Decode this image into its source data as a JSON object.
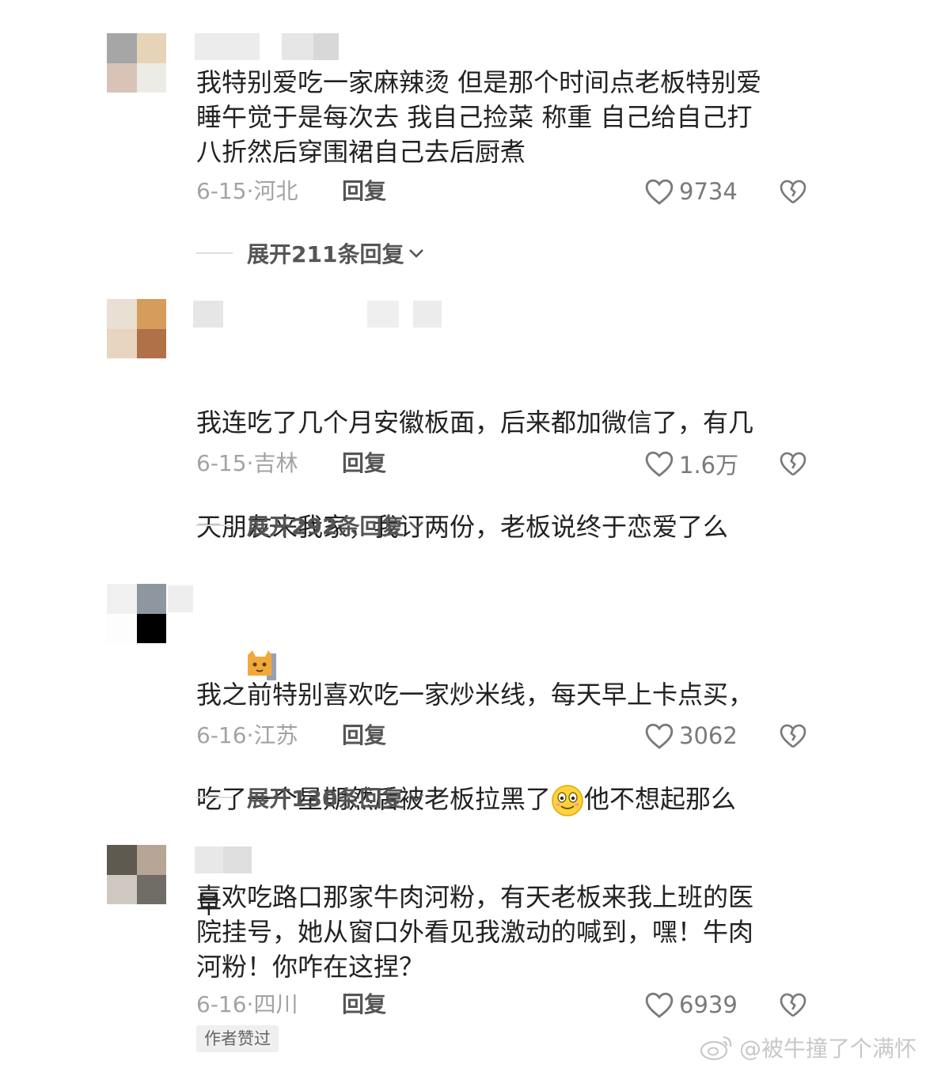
{
  "comments": [
    {
      "text": "我特别爱吃一家麻辣烫 但是那个时间点老板特别爱\n睡午觉于是每次去 我自己捡菜 称重 自己给自己打\n八折然后穿围裙自己去后厨煮",
      "date": "6-15",
      "location": "河北",
      "reply_label": "回复",
      "likes": "9734",
      "expand_label": "展开211条回复"
    },
    {
      "text_line1": "我连吃了几个月安徽板面，后来都加微信了，有几",
      "text_line2": "天朋友来我家，我订两份，老板说终于恋爱了么",
      "emoji": "cat-emoji",
      "date": "6-15",
      "location": "吉林",
      "reply_label": "回复",
      "likes": "1.6万",
      "expand_label": "展开292条回复"
    },
    {
      "text_line1": "我之前特别喜欢吃一家炒米线，每天早上卡点买，",
      "text_line2a": "吃了一个星期然后被老板拉黑了",
      "text_line2b": "他不想起那么",
      "text_line3": "早",
      "emoji": "smile-emoji",
      "date": "6-16",
      "location": "江苏",
      "reply_label": "回复",
      "likes": "3062",
      "expand_label": "展开130条回复"
    },
    {
      "text": "喜欢吃路口那家牛肉河粉，有天老板来我上班的医\n院挂号，她从窗口外看见我激动的喊到，嘿！牛肉\n河粉！你咋在这捏？",
      "date": "6-16",
      "location": "四川",
      "reply_label": "回复",
      "likes": "6939",
      "author_liked": "作者赞过"
    }
  ],
  "watermark": "@被牛撞了个满怀",
  "colors": {
    "text": "#222222",
    "meta": "#a3a3a3",
    "icon": "#7a7a7a"
  }
}
